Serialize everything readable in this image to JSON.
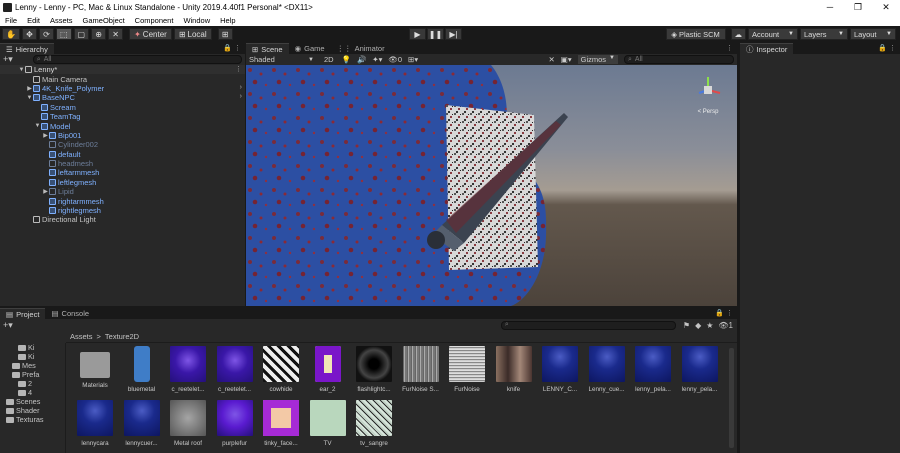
{
  "window": {
    "title": "Lenny - Lenny - PC, Mac & Linux Standalone - Unity 2019.4.40f1 Personal* <DX11>",
    "minimize": "─",
    "maximize": "❐",
    "close": "✕"
  },
  "menu": [
    "File",
    "Edit",
    "Assets",
    "GameObject",
    "Component",
    "Window",
    "Help"
  ],
  "toolbar": {
    "pivot_label": "Center",
    "space_label": "Local",
    "plastic_label": "Plastic SCM",
    "account_label": "Account",
    "layers_label": "Layers",
    "layout_label": "Layout"
  },
  "hierarchy": {
    "tab": "Hierarchy",
    "search_placeholder": "All",
    "items": [
      {
        "label": "Lenny*",
        "depth": 0,
        "style": "root",
        "toggle": "▼"
      },
      {
        "label": "Main Camera",
        "depth": 1,
        "style": "normal",
        "toggle": ""
      },
      {
        "label": "4K_Knife_Polymer",
        "depth": 1,
        "style": "blue",
        "toggle": "▶"
      },
      {
        "label": "BaseNPC",
        "depth": 1,
        "style": "blue",
        "toggle": "▼"
      },
      {
        "label": "Scream",
        "depth": 2,
        "style": "blue",
        "toggle": ""
      },
      {
        "label": "TeamTag",
        "depth": 2,
        "style": "blue",
        "toggle": ""
      },
      {
        "label": "Model",
        "depth": 2,
        "style": "blue",
        "toggle": "▼"
      },
      {
        "label": "Bip001",
        "depth": 3,
        "style": "blue",
        "toggle": "▶"
      },
      {
        "label": "Cylinder002",
        "depth": 3,
        "style": "dim",
        "toggle": ""
      },
      {
        "label": "default",
        "depth": 3,
        "style": "blue",
        "toggle": ""
      },
      {
        "label": "headmesh",
        "depth": 3,
        "style": "dim",
        "toggle": ""
      },
      {
        "label": "leftarmmesh",
        "depth": 3,
        "style": "blue",
        "toggle": ""
      },
      {
        "label": "leftlegmesh",
        "depth": 3,
        "style": "blue",
        "toggle": ""
      },
      {
        "label": "Lipid",
        "depth": 3,
        "style": "dim",
        "toggle": "▶"
      },
      {
        "label": "rightarmmesh",
        "depth": 3,
        "style": "blue",
        "toggle": ""
      },
      {
        "label": "rightlegmesh",
        "depth": 3,
        "style": "blue",
        "toggle": ""
      },
      {
        "label": "Directional Light",
        "depth": 1,
        "style": "normal",
        "toggle": ""
      }
    ]
  },
  "scene": {
    "tabs": [
      "Scene",
      "Game",
      "Animator"
    ],
    "shading": "Shaded",
    "mode": "2D",
    "gizmos": "Gizmos",
    "search_placeholder": "All",
    "gizmo_label": "< Persp"
  },
  "inspector": {
    "tab": "Inspector"
  },
  "project": {
    "tabs": [
      "Project",
      "Console"
    ],
    "breadcrumb": [
      "Assets",
      "Texture2D"
    ],
    "badge": "1",
    "tree": [
      {
        "label": "Ki",
        "depth": 3
      },
      {
        "label": "Ki",
        "depth": 3
      },
      {
        "label": "Mes",
        "depth": 2
      },
      {
        "label": "Prefa",
        "depth": 2
      },
      {
        "label": "2",
        "depth": 3
      },
      {
        "label": "4",
        "depth": 3
      },
      {
        "label": "Scenes",
        "depth": 1
      },
      {
        "label": "Shader",
        "depth": 1
      },
      {
        "label": "Texturas",
        "depth": 1
      }
    ],
    "assets": [
      {
        "label": "Materials",
        "kind": "folder",
        "color": "#9a9a9a"
      },
      {
        "label": "bluemetal",
        "kind": "tall",
        "color": "#3f7dc7"
      },
      {
        "label": "c_reetelet...",
        "kind": "purple",
        "color": "#3a17a8"
      },
      {
        "label": "c_reetelet...",
        "kind": "purple",
        "color": "#3a17a8"
      },
      {
        "label": "cowhide",
        "kind": "cow",
        "color": "#e8e8e8"
      },
      {
        "label": "ear_2",
        "kind": "ear",
        "color": "#7a16c9"
      },
      {
        "label": "flashlightc...",
        "kind": "flash",
        "color": "#111111"
      },
      {
        "label": "FurNoise S...",
        "kind": "noise",
        "color": "#8a8a8a"
      },
      {
        "label": "FurNoise",
        "kind": "noise2",
        "color": "#bbbbbb"
      },
      {
        "label": "knife",
        "kind": "knife",
        "color": "#5a4a44"
      },
      {
        "label": "LENNY_C...",
        "kind": "navy",
        "color": "#1a2a8c"
      },
      {
        "label": "Lenny_cue...",
        "kind": "navy",
        "color": "#1b3195"
      },
      {
        "label": "lenny_pela...",
        "kind": "navy",
        "color": "#16227a"
      },
      {
        "label": "lenny_pela...",
        "kind": "navy",
        "color": "#16227a"
      },
      {
        "label": "lennycara",
        "kind": "navy",
        "color": "#1a2a8c"
      },
      {
        "label": "lennycuer...",
        "kind": "navy",
        "color": "#1b3195"
      },
      {
        "label": "Metal roof",
        "kind": "metal",
        "color": "#6e6e6e"
      },
      {
        "label": "purplefur",
        "kind": "purple",
        "color": "#5a1bd0"
      },
      {
        "label": "tinky_face...",
        "kind": "face",
        "color": "#a62ad6"
      },
      {
        "label": "TV",
        "kind": "tv",
        "color": "#b9d7bd"
      },
      {
        "label": "tv_sangre",
        "kind": "sangre",
        "color": "#c3d3c7"
      }
    ]
  }
}
